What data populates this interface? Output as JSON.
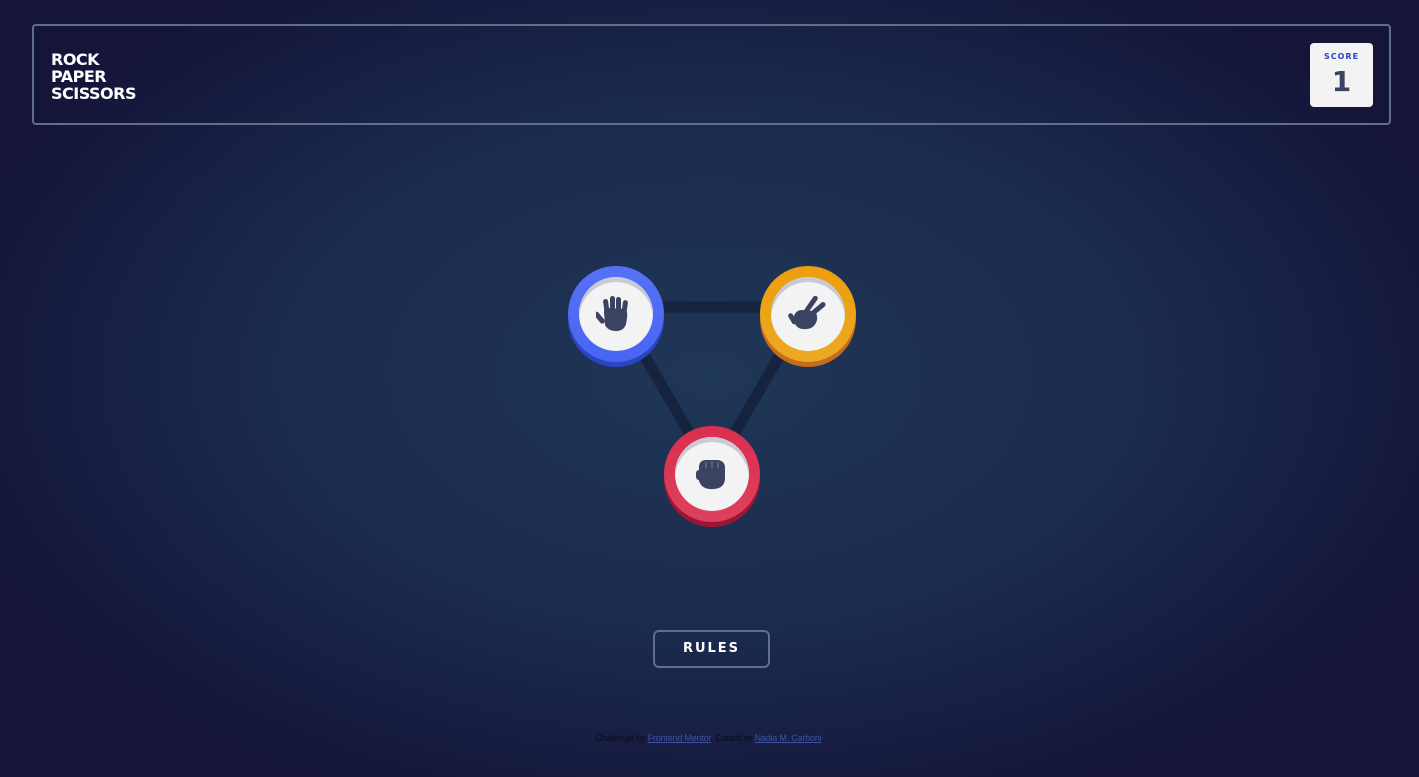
{
  "header": {
    "title_lines": [
      "ROCK",
      "PAPER",
      "SCISSORS"
    ],
    "score_label": "SCORE",
    "score_value": "1"
  },
  "tokens": [
    {
      "name": "paper",
      "icon": "paper-hand-icon",
      "color": "#4865f4",
      "shadow": "#2a45c2"
    },
    {
      "name": "scissors",
      "icon": "scissors-hand-icon",
      "color": "#eca922",
      "shadow": "#c76c1b"
    },
    {
      "name": "rock",
      "icon": "rock-fist-icon",
      "color": "#dd405d",
      "shadow": "#9d1634"
    }
  ],
  "rules_button_label": "RULES",
  "attribution": {
    "prefix": "Challenge by",
    "challenge_link": "Frontend Mentor",
    "middle": ". Coded by",
    "author_link": "Nadia M. Carboni",
    "suffix": "."
  },
  "colors": {
    "background_center": "#1f3756",
    "background_edge": "#141539",
    "outline": "#5f6f87",
    "score_text": "#3b4363",
    "score_label": "#2a45c2"
  }
}
